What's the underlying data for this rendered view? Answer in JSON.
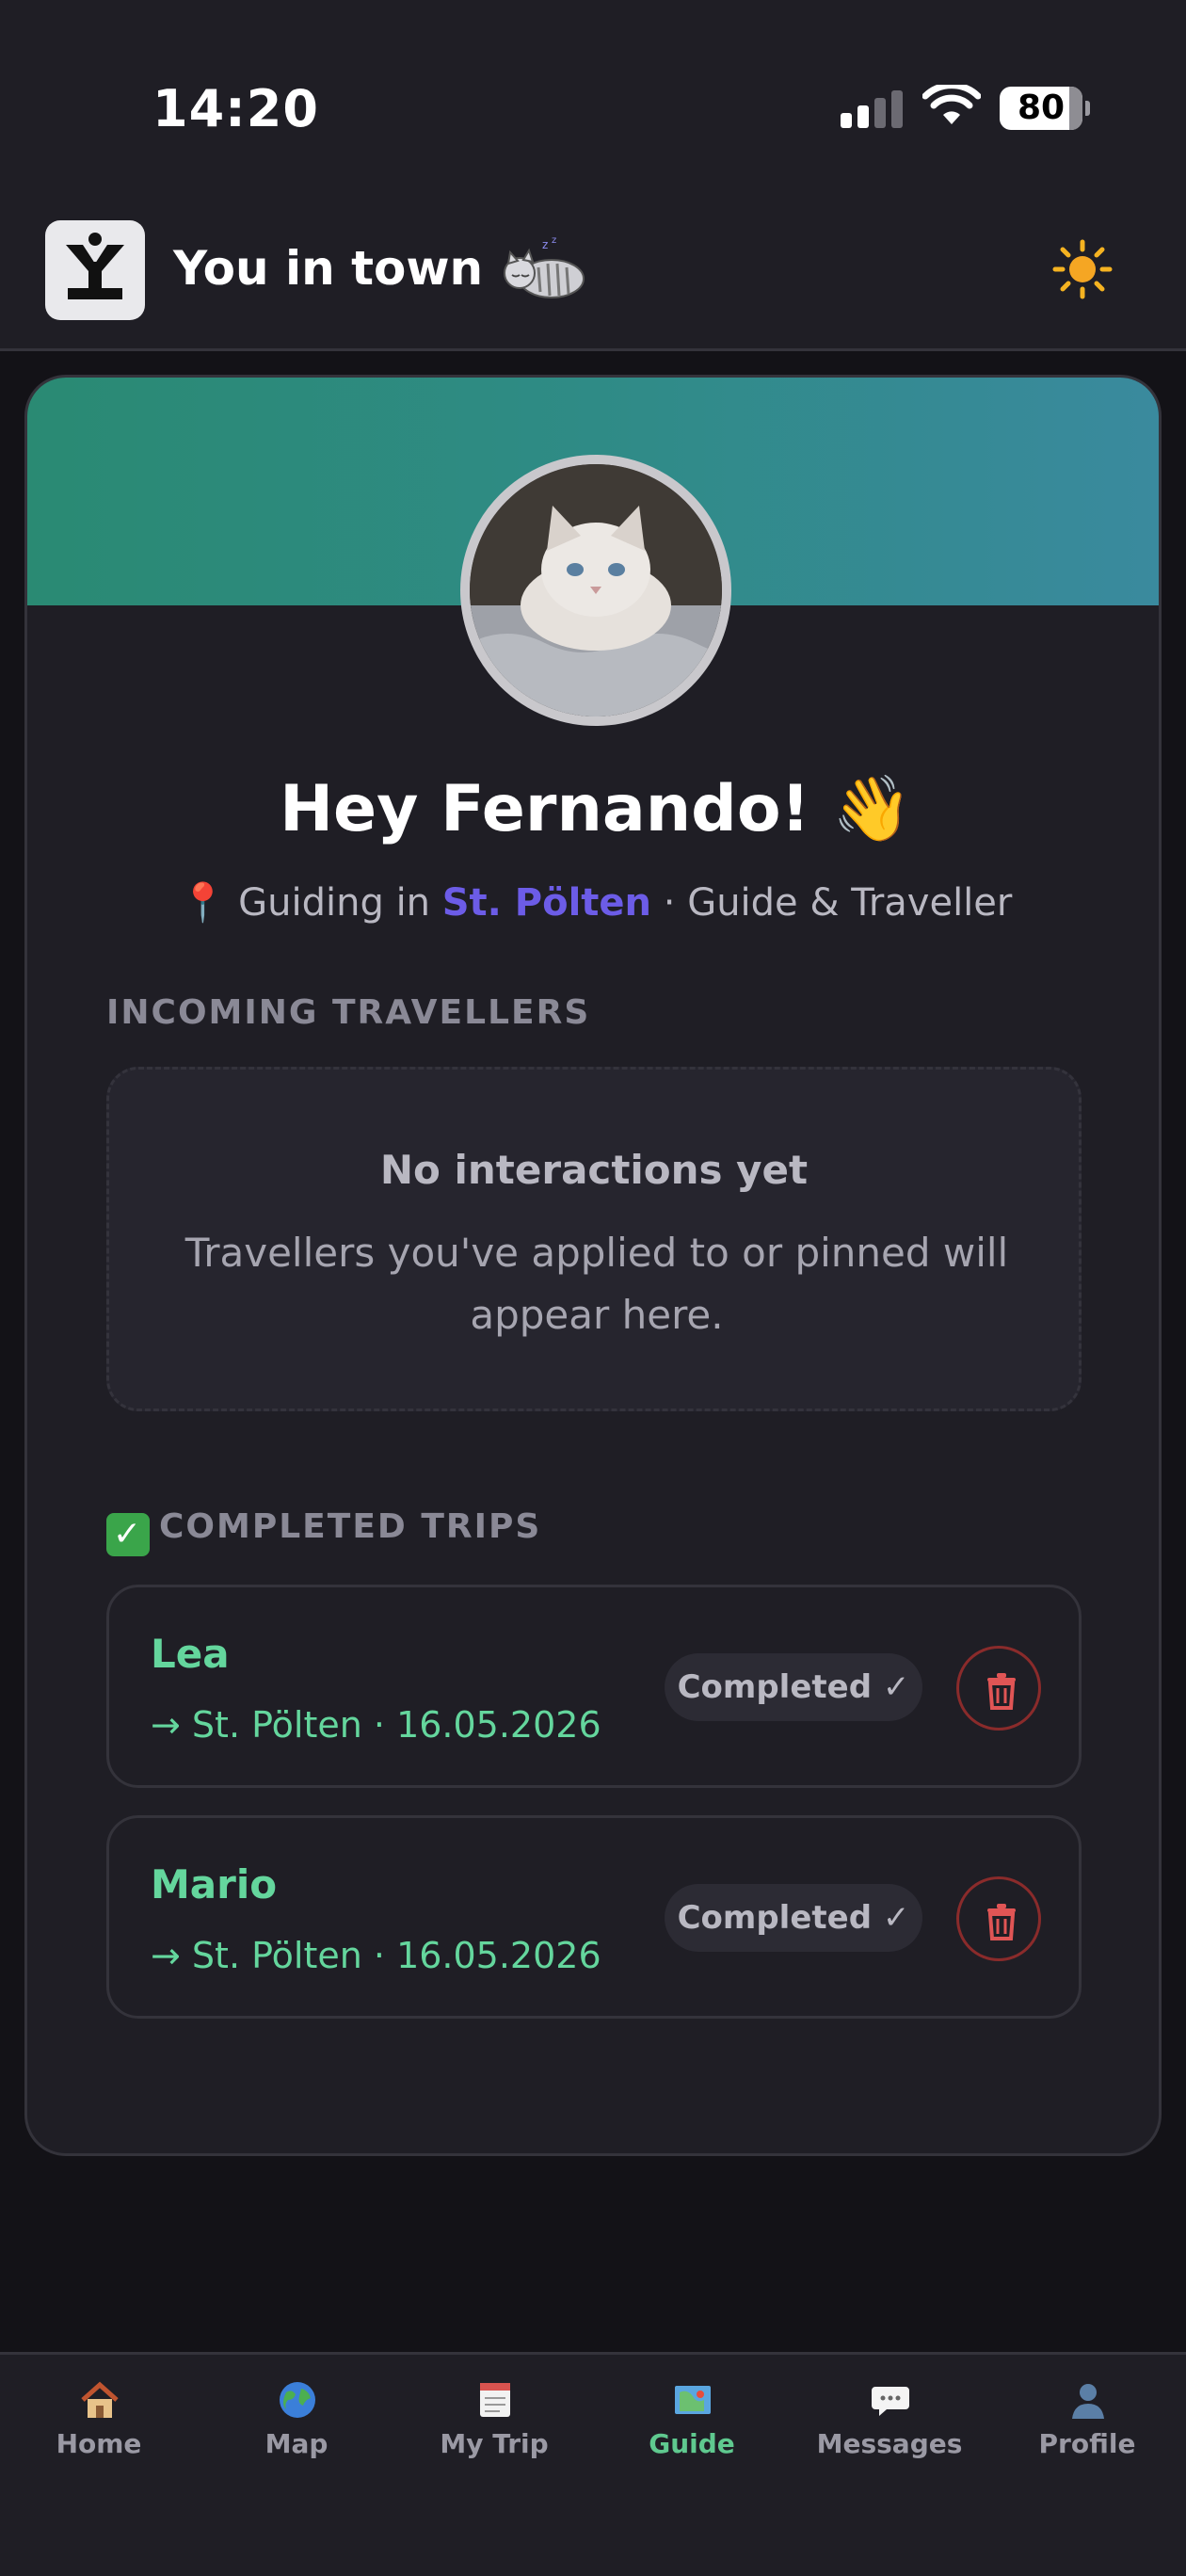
{
  "status_bar": {
    "time": "14:20",
    "battery": "80",
    "icons": [
      "signal-icon",
      "wifi-icon",
      "battery-icon"
    ]
  },
  "header": {
    "title": "You in town",
    "logo_letter": "Y",
    "icons": [
      "app-logo-icon",
      "sleeping-cat-icon",
      "sun-icon"
    ]
  },
  "profile": {
    "greeting": "Hey Fernando! 👋",
    "location_prefix": "📍 Guiding in ",
    "city": "St. Pölten",
    "role_suffix": " · Guide & Traveller"
  },
  "incoming": {
    "label": "INCOMING TRAVELLERS",
    "empty_title": "No interactions yet",
    "empty_text": "Travellers you've applied to or pinned will appear here."
  },
  "completed": {
    "icon": "✓",
    "label": "COMPLETED TRIPS",
    "trips": [
      {
        "name": "Lea",
        "detail": "→ St. Pölten · 16.05.2026",
        "status": "Completed ✓"
      },
      {
        "name": "Mario",
        "detail": "→ St. Pölten · 16.05.2026",
        "status": "Completed ✓"
      }
    ]
  },
  "nav": {
    "items": [
      {
        "label": "Home",
        "icon": "house-icon"
      },
      {
        "label": "Map",
        "icon": "globe-icon"
      },
      {
        "label": "My Trip",
        "icon": "notepad-icon"
      },
      {
        "label": "Guide",
        "icon": "map-icon",
        "active": true
      },
      {
        "label": "Messages",
        "icon": "speech-bubble-icon"
      },
      {
        "label": "Profile",
        "icon": "person-icon"
      }
    ]
  },
  "colors": {
    "background": "#1f1e25",
    "accent_green": "#64d69d",
    "accent_purple": "#6c5ce7",
    "danger": "#e05555"
  }
}
